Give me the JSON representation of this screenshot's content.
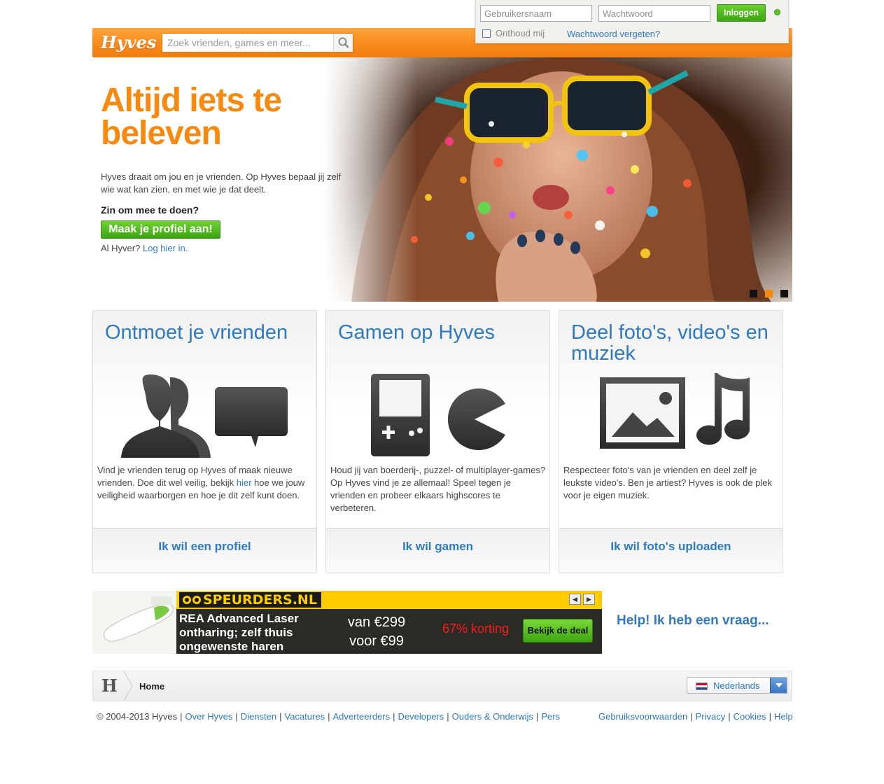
{
  "header": {
    "logo": "Hyves",
    "search_placeholder": "Zoek vrienden, games en meer..."
  },
  "login": {
    "username_placeholder": "Gebruikersnaam",
    "password_placeholder": "Wachtwoord",
    "login_button": "Inloggen",
    "remember_label": "Onthoud mij",
    "forgot_link": "Wachtwoord vergeten?"
  },
  "hero": {
    "title": "Altijd iets te beleven",
    "text": "Hyves draait om jou en je vrienden. Op Hyves bepaal jij zelf wie wat kan zien, en met wie je dat deelt.",
    "question": "Zin om mee te doen?",
    "cta_button": "Maak je profiel aan!",
    "login_prefix": "Al Hyver?",
    "login_link": "Log hier in.",
    "slide_count": 3,
    "active_slide": 2
  },
  "cards": [
    {
      "title": "Ontmoet je vrienden",
      "text_before": "Vind je vrienden terug op Hyves of maak nieuwe vrienden. Doe dit wel veilig, bekijk ",
      "text_link": "hier",
      "text_after": " hoe we jouw veiligheid waarborgen en hoe je dit zelf kunt doen.",
      "footer_link": "Ik wil een profiel",
      "icons": [
        "people-icon",
        "speech-bubble-icon"
      ]
    },
    {
      "title": "Gamen op Hyves",
      "text": "Houd jij van boerderij-, puzzel- of multiplayer-games? Op Hyves vind je ze allemaal! Speel tegen je vrienden en probeer elkaars highscores te verbeteren.",
      "footer_link": "Ik wil gamen",
      "icons": [
        "gameboy-icon",
        "pacman-icon"
      ]
    },
    {
      "title": "Deel foto's, video's en muziek",
      "text": "Respecteer foto's van je vrienden en deel zelf je leukste video's. Ben je artiest? Hyves is ook de plek voor je eigen muziek.",
      "footer_link": "Ik wil foto's uploaden",
      "icons": [
        "photo-icon",
        "music-note-icon"
      ]
    }
  ],
  "ad": {
    "brand": "SPEURDERS.NL",
    "product": "REA Advanced Laser ontharing; zelf thuis ongewenste haren",
    "price_from": "van €299",
    "price_to": "voor €99",
    "discount": "67% korting",
    "deal_button": "Bekijk de deal"
  },
  "help_link": "Help! Ik heb een vraag...",
  "breadcrumb": {
    "logo": "H",
    "home": "Home"
  },
  "language": {
    "selected": "Nederlands"
  },
  "footer": {
    "copyright": "© 2004-2013 Hyves",
    "left_links": [
      "Over Hyves",
      "Diensten",
      "Vacatures",
      "Adverteerders",
      "Developers",
      "Ouders & Onderwijs",
      "Pers"
    ],
    "right_links": [
      "Gebruiksvoorwaarden",
      "Privacy",
      "Cookies",
      "Help"
    ]
  },
  "colors": {
    "orange": "#f7890f",
    "blue": "#2f7ac0",
    "green": "#4cb51d"
  }
}
